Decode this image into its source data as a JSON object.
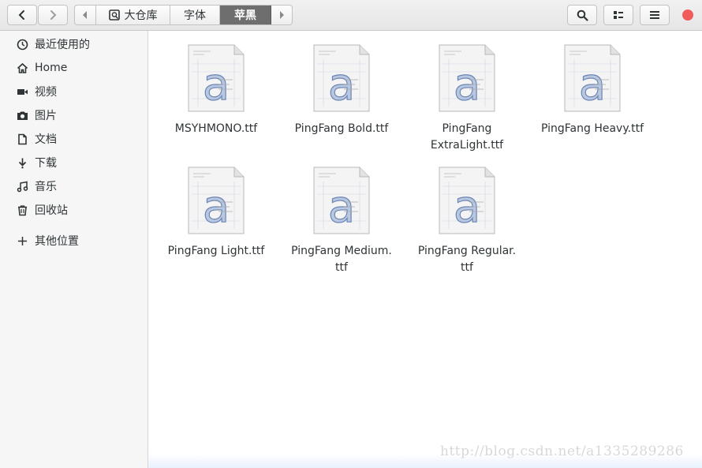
{
  "header": {
    "back_icon": "chevron-left-icon",
    "forward_icon": "chevron-right-icon",
    "path_left_icon": "caret-left-icon",
    "path_right_icon": "caret-right-icon",
    "path": [
      {
        "label": "大仓库",
        "icon": "drive-icon",
        "active": false
      },
      {
        "label": "字体",
        "active": false
      },
      {
        "label": "苹黑",
        "active": true
      }
    ],
    "search_icon": "search-icon",
    "view_icon": "list-view-icon",
    "menu_icon": "hamburger-menu-icon",
    "close_color": "#f25b5b"
  },
  "sidebar": {
    "items": [
      {
        "label": "最近使用的",
        "icon": "clock-icon"
      },
      {
        "label": "Home",
        "icon": "home-icon"
      },
      {
        "label": "视频",
        "icon": "video-icon"
      },
      {
        "label": "图片",
        "icon": "camera-icon"
      },
      {
        "label": "文档",
        "icon": "document-icon"
      },
      {
        "label": "下载",
        "icon": "download-icon"
      },
      {
        "label": "音乐",
        "icon": "music-icon"
      },
      {
        "label": "回收站",
        "icon": "trash-icon"
      },
      {
        "label": "其他位置",
        "icon": "plus-icon"
      }
    ]
  },
  "files": [
    {
      "name": "MSYHMONO.ttf",
      "icon": "font-file-icon"
    },
    {
      "name": "PingFang Bold.ttf",
      "icon": "font-file-icon"
    },
    {
      "name": "PingFang\nExtraLight.ttf",
      "icon": "font-file-icon"
    },
    {
      "name": "PingFang Heavy.ttf",
      "icon": "font-file-icon"
    },
    {
      "name": "PingFang Light.ttf",
      "icon": "font-file-icon"
    },
    {
      "name": "PingFang Medium.\nttf",
      "icon": "font-file-icon"
    },
    {
      "name": "PingFang Regular.\nttf",
      "icon": "font-file-icon"
    }
  ],
  "watermark": "http://blog.csdn.net/a1335289286"
}
